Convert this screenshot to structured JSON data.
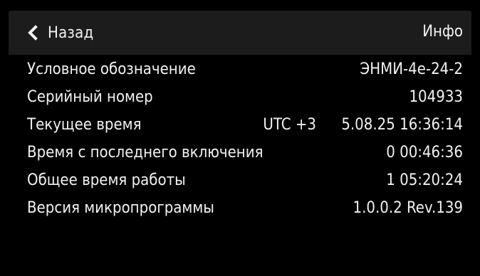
{
  "header": {
    "back_label": "Назад",
    "title": "Инфо",
    "back_icon": "chevron-left-icon"
  },
  "info": {
    "rows": [
      {
        "label": "Условное обозначение",
        "value": "ЭНМИ-4е-24-2"
      },
      {
        "label": "Серийный номер",
        "value": "104933"
      },
      {
        "label": "Текущее время",
        "timezone": "UTC +3",
        "value": "5.08.25 16:36:14"
      },
      {
        "label": "Время с последнего включения",
        "value": "0 00:46:36"
      },
      {
        "label": "Общее время работы",
        "value": "1 05:20:24"
      },
      {
        "label": "Версия микропрограммы",
        "value": "1.0.0.2 Rev.139"
      }
    ]
  },
  "colors": {
    "background": "#000000",
    "header_background": "#1c1c1c",
    "text": "#f2f2f2"
  }
}
